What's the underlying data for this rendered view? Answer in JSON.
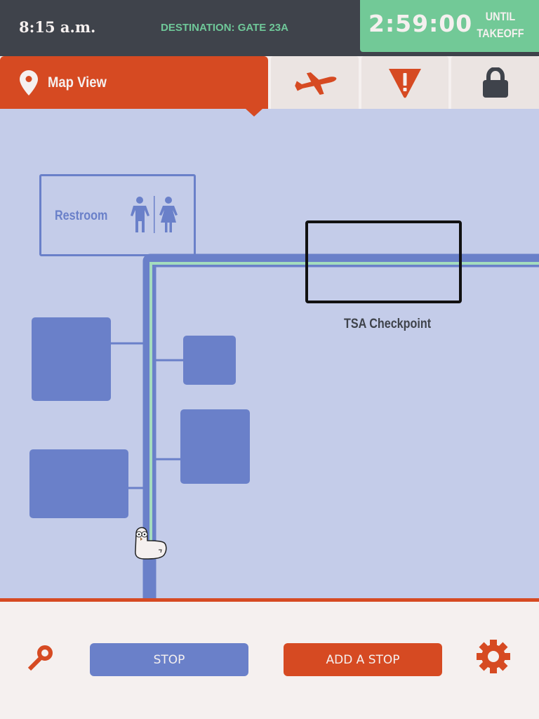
{
  "status_bar": {
    "time": "8:15 a.m.",
    "destination": "DESTINATION: GATE 23A",
    "countdown": "2:59:00",
    "countdown_label_line1": "UNTIL",
    "countdown_label_line2": "TAKEOFF"
  },
  "tabs": [
    {
      "label": "Map View",
      "icon": "map-pin-icon",
      "active": true
    },
    {
      "label": "",
      "icon": "airplane-icon",
      "active": false
    },
    {
      "label": "",
      "icon": "warning-icon",
      "active": false
    },
    {
      "label": "",
      "icon": "lock-icon",
      "active": false
    }
  ],
  "map": {
    "restroom_label": "Restroom",
    "checkpoint_label": "TSA Checkpoint"
  },
  "bottom_bar": {
    "search_icon": "search-icon",
    "stop_label": "STOP",
    "add_stop_label": "ADD A STOP",
    "settings_icon": "gear-icon"
  },
  "colors": {
    "accent": "#d64a22",
    "blue": "#6a80c9",
    "green": "#72c997",
    "dark": "#3f434b",
    "map_bg": "#c4cce9"
  }
}
